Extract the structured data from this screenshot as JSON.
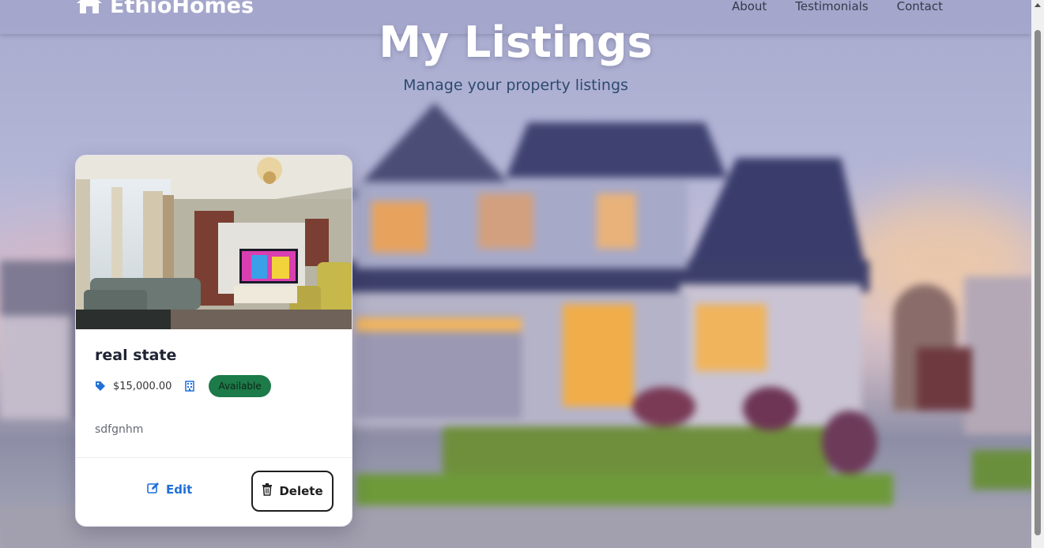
{
  "brand": {
    "name": "EthioHomes",
    "icon": "house-icon"
  },
  "nav": {
    "items": [
      {
        "label": "About"
      },
      {
        "label": "Testimonials"
      },
      {
        "label": "Contact"
      }
    ]
  },
  "hero": {
    "title": "My Listings",
    "subtitle": "Manage your property listings"
  },
  "listings": [
    {
      "title": "real state",
      "price": "$15,000.00",
      "price_icon": "price-tag-icon",
      "type_icon": "building-icon",
      "status": "Available",
      "description": "sdfgnhm",
      "actions": {
        "edit_label": "Edit",
        "delete_label": "Delete"
      }
    }
  ],
  "colors": {
    "accent": "#1f6fd8",
    "status_available": "#1d7a49",
    "title_text": "#1e2433",
    "subtitle_text": "#2d4a6e"
  }
}
